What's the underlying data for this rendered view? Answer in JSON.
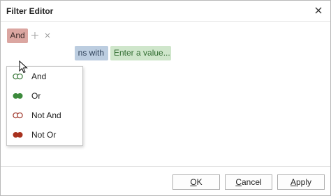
{
  "window": {
    "title": "Filter Editor"
  },
  "group": {
    "operator_label": "And"
  },
  "condition": {
    "operator_text": "ns with",
    "value_placeholder": "Enter a value..."
  },
  "menu": {
    "items": [
      {
        "label": "And",
        "icon": "and-icon",
        "colors": [
          "#ffffff",
          "#ffffff"
        ],
        "outline": "#3c7a3c"
      },
      {
        "label": "Or",
        "icon": "or-icon",
        "colors": [
          "#3c8a3c",
          "#3c8a3c"
        ],
        "outline": "#3c8a3c"
      },
      {
        "label": "Not And",
        "icon": "not-and-icon",
        "colors": [
          "#ffffff",
          "#ffffff"
        ],
        "outline": "#a13a2e"
      },
      {
        "label": "Not Or",
        "icon": "not-or-icon",
        "colors": [
          "#a8321f",
          "#a8321f"
        ],
        "outline": "#a8321f"
      }
    ]
  },
  "footer": {
    "ok": {
      "mnemonic": "O",
      "rest": "K"
    },
    "cancel": {
      "mnemonic": "C",
      "rest": "ancel"
    },
    "apply": {
      "mnemonic": "A",
      "rest": "pply"
    }
  }
}
